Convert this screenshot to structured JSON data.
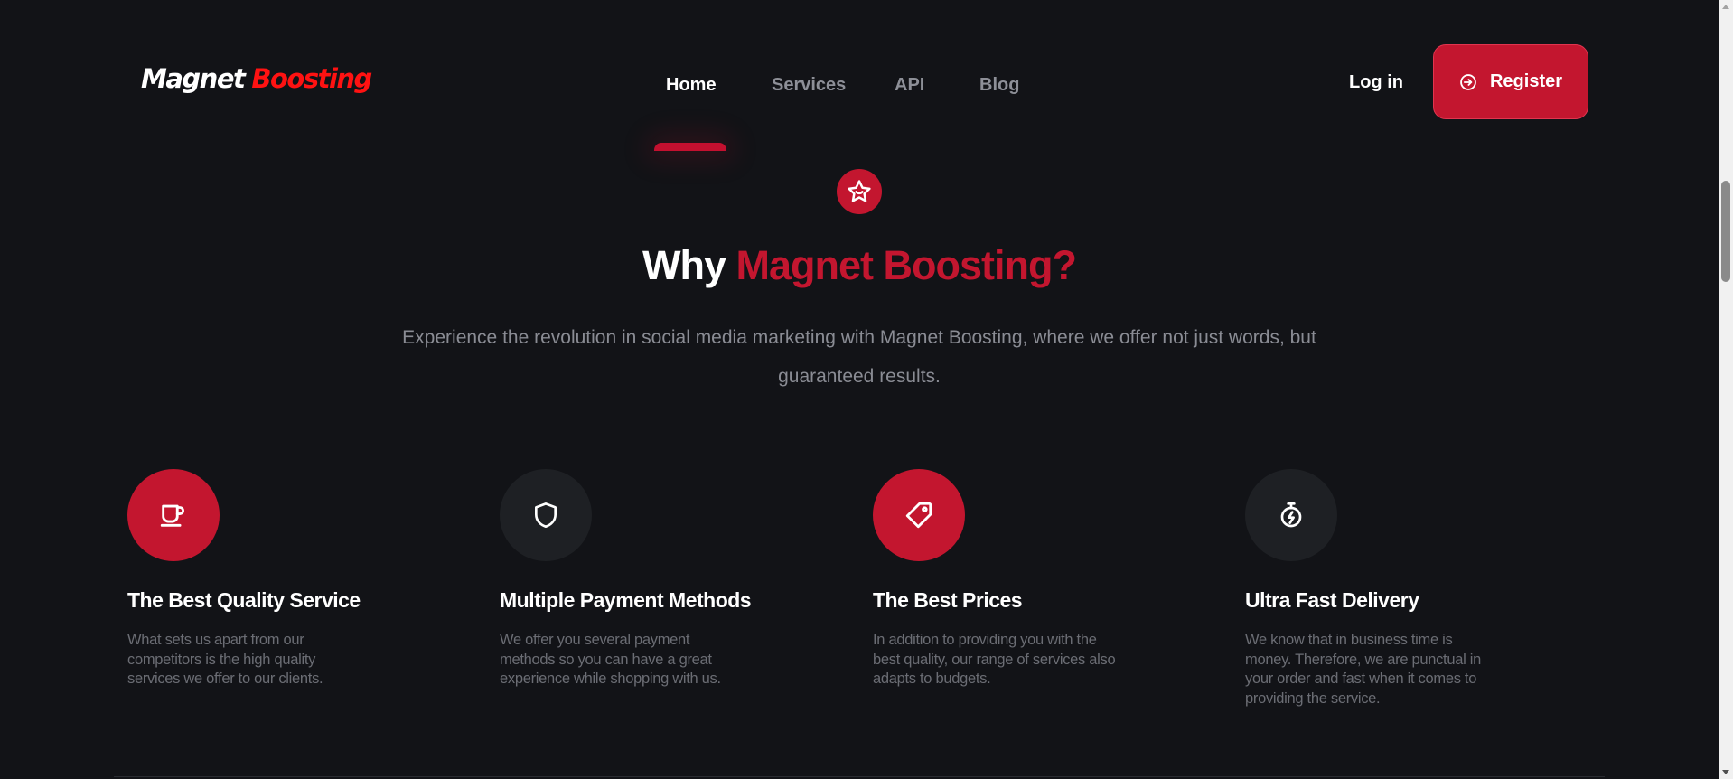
{
  "header": {
    "logo_word1": "Magnet",
    "logo_word2": "Boosting",
    "nav": [
      {
        "label": "Home",
        "active": true
      },
      {
        "label": "Services",
        "active": false
      },
      {
        "label": "API",
        "active": false
      },
      {
        "label": "Blog",
        "active": false
      }
    ],
    "login_label": "Log in",
    "register_label": "Register"
  },
  "hero": {
    "icon": "star-icon",
    "headline_prefix": "Why",
    "headline_accent": "Magnet Boosting?",
    "subtext": "Experience the revolution in social media marketing with Magnet Boosting, where we offer not just words, but guaranteed results."
  },
  "features": [
    {
      "icon": "coffee-cup-icon",
      "title": "The Best Quality Service",
      "description": "What sets us apart from our competitors is the high quality services we offer to our clients."
    },
    {
      "icon": "shield-icon",
      "title": "Multiple Payment Methods",
      "description": "We offer you several payment methods so you can have a great experience while shopping with us."
    },
    {
      "icon": "price-tag-icon",
      "title": "The Best Prices",
      "description": "In addition to providing you with the best quality, our range of services also adapts to budgets."
    },
    {
      "icon": "stopwatch-icon",
      "title": "Ultra Fast Delivery",
      "description": "We know that in business time is money. Therefore, we are punctual in your order and fast when it comes to providing the service."
    }
  ],
  "colors": {
    "background": "#121317",
    "accent": "#c3162f",
    "logo_red": "#ff1212",
    "muted_text": "#8a8c94",
    "dark_circle": "#1e2024"
  }
}
